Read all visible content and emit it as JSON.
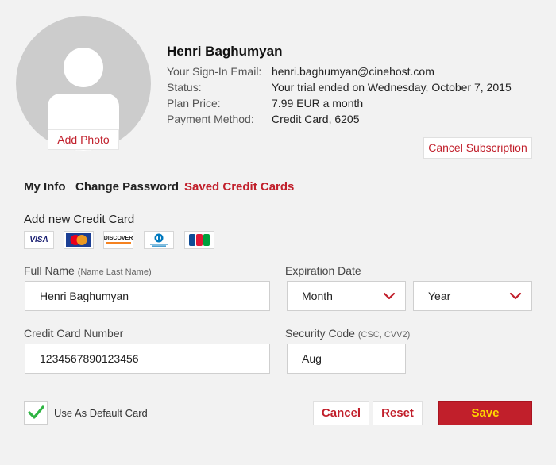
{
  "profile": {
    "add_photo": "Add Photo",
    "name": "Henri Baghumyan",
    "email_label": "Your Sign-In Email:",
    "email": "henri.baghumyan@cinehost.com",
    "status_label": "Status:",
    "status": "Your trial ended on Wednesday, October 7, 2015",
    "plan_label": "Plan Price:",
    "plan": "7.99 EUR a month",
    "payment_label": "Payment Method:",
    "payment": "Credit Card, 6205",
    "cancel_subscription": "Cancel Subscription"
  },
  "tabs": [
    "My Info",
    "Change Password",
    "Saved Credit Cards"
  ],
  "active_tab": "Saved Credit Cards",
  "form": {
    "section_title": "Add new Credit Card",
    "card_brands": [
      "VISA",
      "MasterCard",
      "DISCOVER",
      "Diners Club International",
      "JCB"
    ],
    "full_name_label": "Full Name",
    "full_name_hint": "(Name Last Name)",
    "full_name_value": "Henri Baghumyan",
    "expiration_label": "Expiration Date",
    "month_value": "Month",
    "year_value": "Year",
    "card_number_label": "Credit Card Number",
    "card_number_value": "1234567890123456",
    "security_label": "Security Code",
    "security_hint": "(CSC, CVV2)",
    "security_value": "Aug",
    "default_label": "Use As Default Card",
    "default_checked": true
  },
  "buttons": {
    "cancel": "Cancel",
    "reset": "Reset",
    "save": "Save"
  },
  "colors": {
    "accent": "#c11f2b",
    "save_text": "#ffd800",
    "check": "#2fb543"
  }
}
